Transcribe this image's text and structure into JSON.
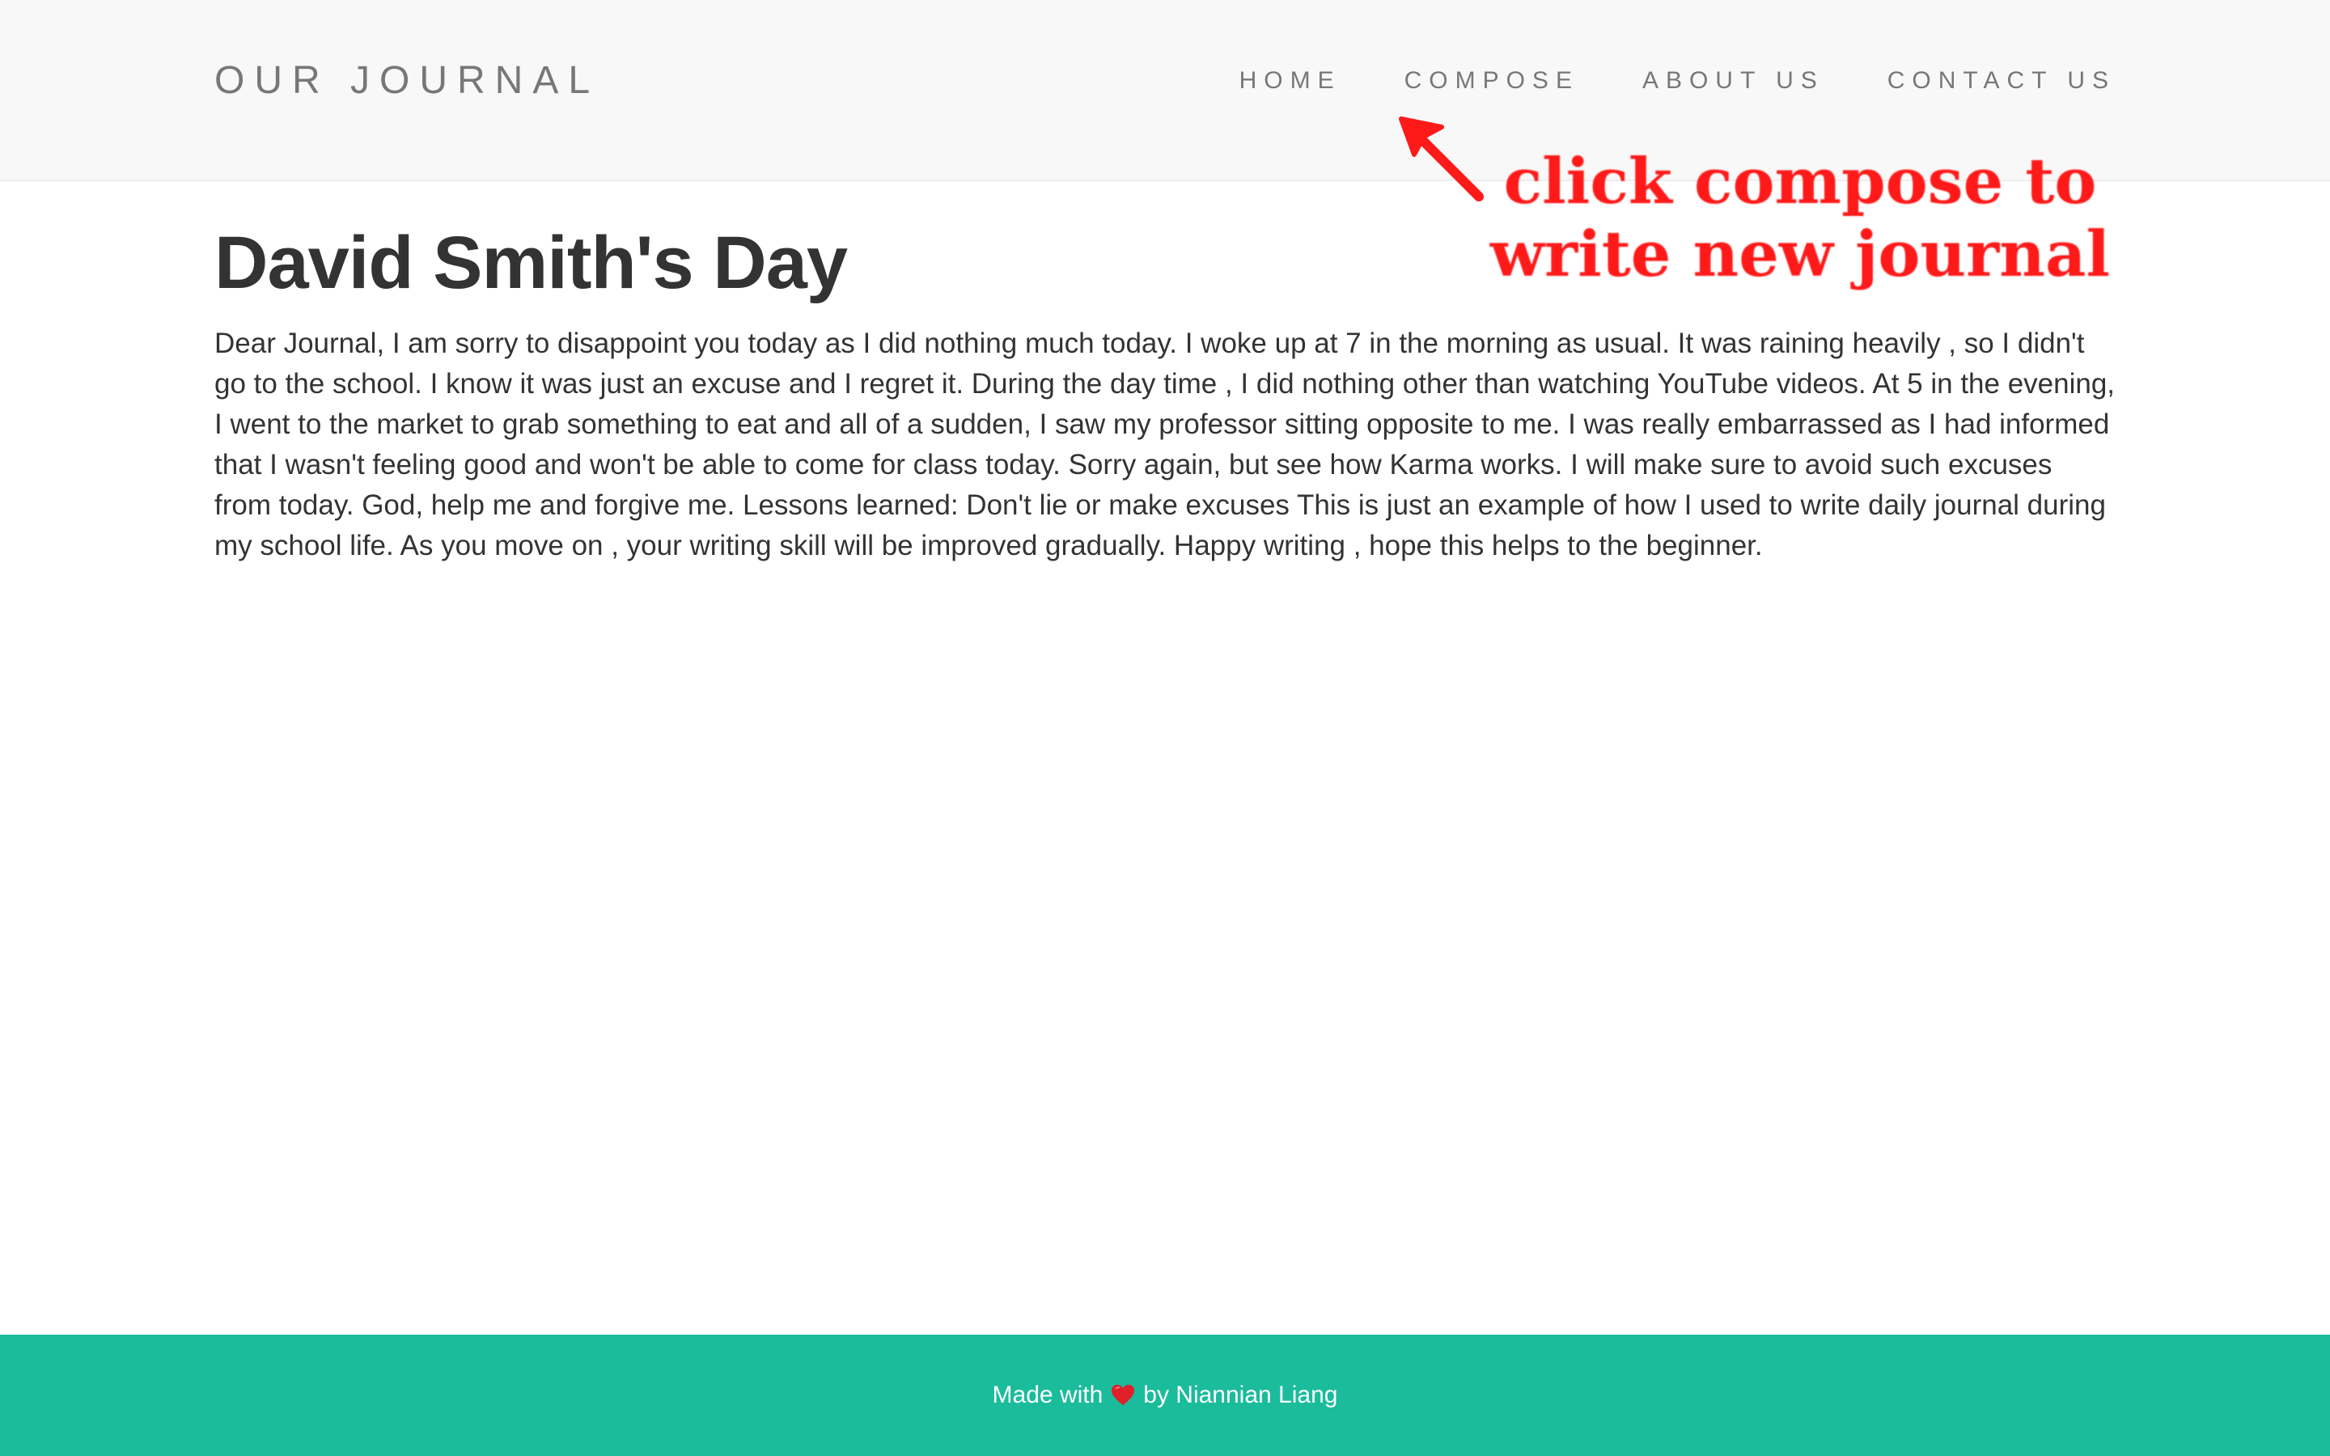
{
  "navbar": {
    "brand": "OUR JOURNAL",
    "links": [
      {
        "label": "HOME"
      },
      {
        "label": "COMPOSE"
      },
      {
        "label": "ABOUT US"
      },
      {
        "label": "CONTACT US"
      }
    ]
  },
  "annotation": {
    "line1": "click compose to",
    "line2": "write new journal",
    "color": "#ff1a1a"
  },
  "post": {
    "title": "David Smith's Day",
    "body": "Dear Journal, I am sorry to disappoint you today as I did nothing much today. I woke up at 7 in the morning as usual. It was raining heavily , so I didn't go to the school. I know it was just an excuse and I regret it. During the day time , I did nothing other than watching YouTube videos. At 5 in the evening, I went to the market to grab something to eat and all of a sudden, I saw my professor sitting opposite to me. I was really embarrassed as I had informed that I wasn't feeling good and won't be able to come for class today. Sorry again, but see how Karma works. I will make sure to avoid such excuses from today. God, help me and forgive me. Lessons learned: Don't lie or make excuses This is just an example of how I used to write daily journal during my school life. As you move on , your writing skill will be improved gradually. Happy writing , hope this helps to the beginner."
  },
  "footer": {
    "made_with": "Made with",
    "heart_icon": "heart-icon",
    "by": "by Niannian Liang",
    "color": "#1abc9c"
  },
  "colors": {
    "navbar_bg": "#f8f8f8",
    "nav_text": "#777777",
    "body_text": "#333333",
    "footer_bg": "#1abc9c"
  }
}
